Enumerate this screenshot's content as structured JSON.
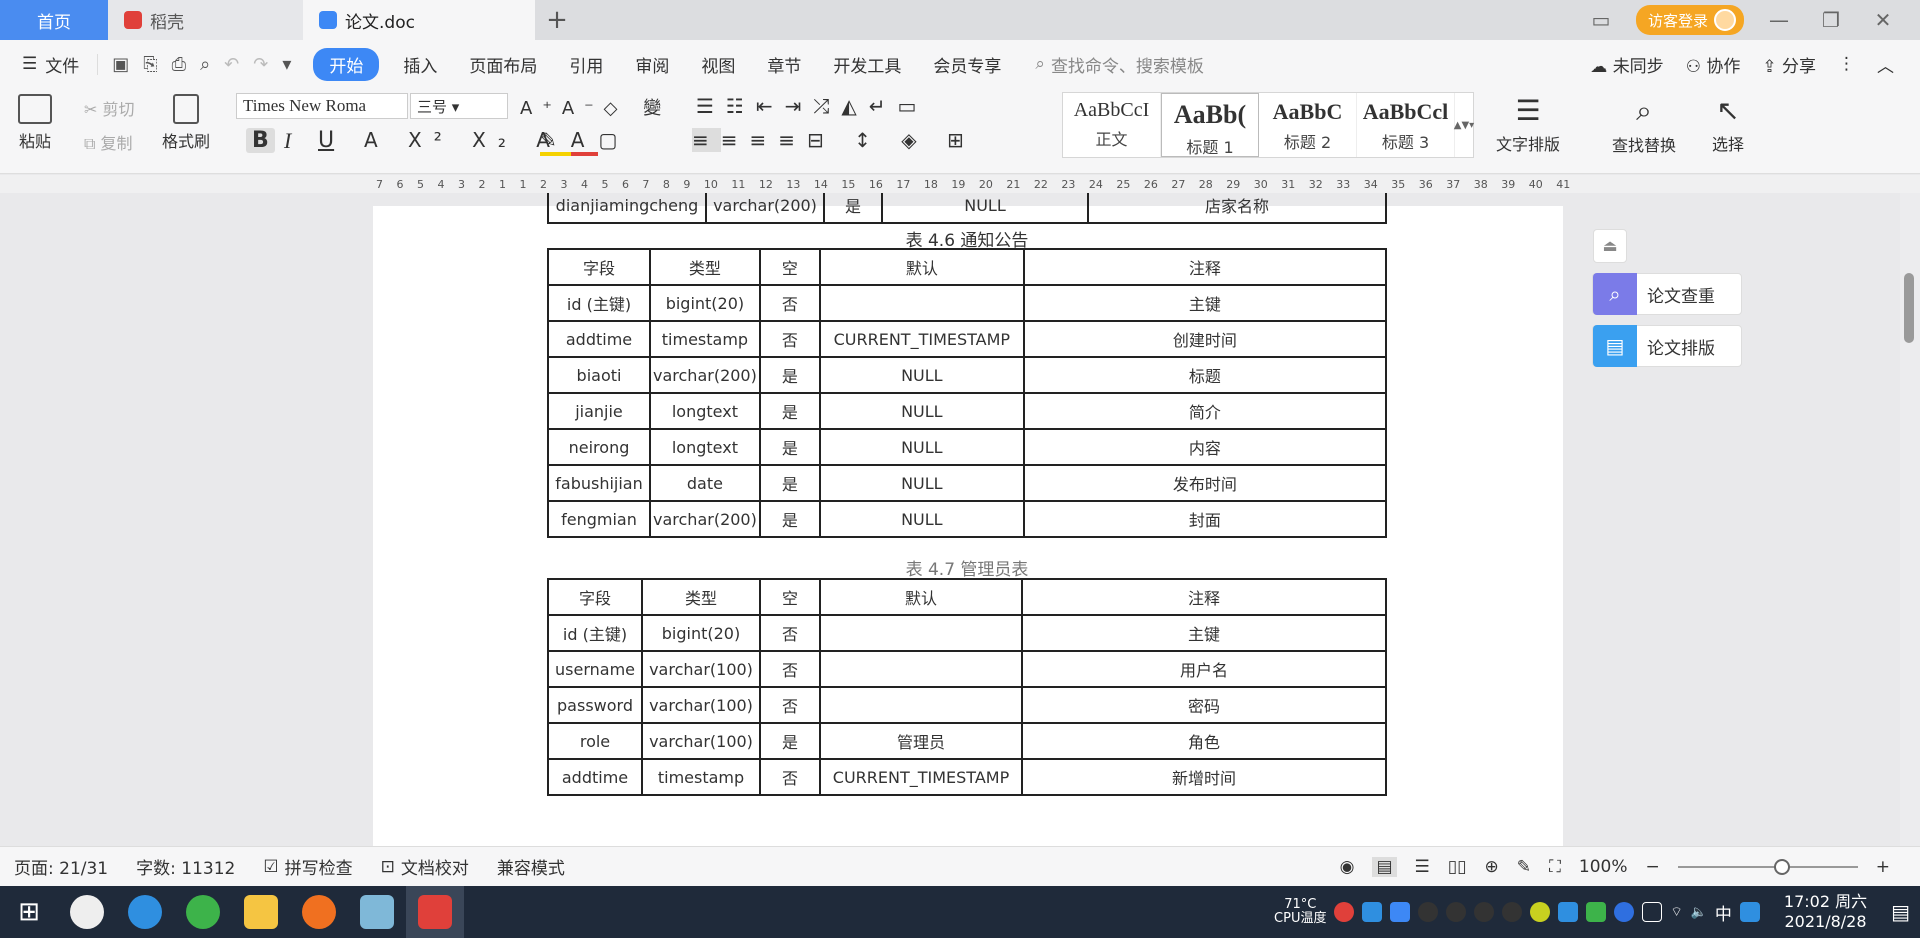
{
  "tabs": {
    "home": "首页",
    "daoke": "稻壳",
    "doc": "论文.doc",
    "login": "访客登录"
  },
  "menu": {
    "file": "文件",
    "items": [
      "开始",
      "插入",
      "页面布局",
      "引用",
      "审阅",
      "视图",
      "章节",
      "开发工具",
      "会员专享"
    ],
    "search_placeholder": "查找命令、搜索模板",
    "sync": "未同步",
    "collab": "协作",
    "share": "分享"
  },
  "ribbon": {
    "paste": "粘贴",
    "cut": "剪切",
    "copy": "复制",
    "format_painter": "格式刷",
    "font_name": "Times New Roma",
    "font_size": "三号",
    "styles": [
      {
        "sample": "AaBbCcI",
        "label": "正文"
      },
      {
        "sample": "AaBb(",
        "label": "标题 1"
      },
      {
        "sample": "AaBbC",
        "label": "标题 2"
      },
      {
        "sample": "AaBbCcl",
        "label": "标题 3"
      }
    ],
    "text_layout": "文字排版",
    "find_replace": "查找替换",
    "select": "选择"
  },
  "ruler_ticks": "7 6 5 4 3 2 1 1 2 3 4 5 6 7 8 9 10 11 12 13 14 15 16 17 18 19 20 21 22 23 24 25 26 27 28 29 30 31 32 33 34 35 36 37 38 39 40 41",
  "document": {
    "prev_row": [
      "dianjiamingcheng",
      "varchar(200)",
      "是",
      "NULL",
      "店家名称"
    ],
    "table6": {
      "caption": "表 4.6 通知公告",
      "header": [
        "字段",
        "类型",
        "空",
        "默认",
        "注释"
      ],
      "rows": [
        [
          "id (主键)",
          "bigint(20)",
          "否",
          "",
          "主键"
        ],
        [
          "addtime",
          "timestamp",
          "否",
          "CURRENT_TIMESTAMP",
          "创建时间"
        ],
        [
          "biaoti",
          "varchar(200)",
          "是",
          "NULL",
          "标题"
        ],
        [
          "jianjie",
          "longtext",
          "是",
          "NULL",
          "简介"
        ],
        [
          "neirong",
          "longtext",
          "是",
          "NULL",
          "内容"
        ],
        [
          "fabushijian",
          "date",
          "是",
          "NULL",
          "发布时间"
        ],
        [
          "fengmian",
          "varchar(200)",
          "是",
          "NULL",
          "封面"
        ]
      ]
    },
    "table7": {
      "caption": "表 4.7 管理员表",
      "header": [
        "字段",
        "类型",
        "空",
        "默认",
        "注释"
      ],
      "rows": [
        [
          "id (主键)",
          "bigint(20)",
          "否",
          "",
          "主键"
        ],
        [
          "username",
          "varchar(100)",
          "否",
          "",
          "用户名"
        ],
        [
          "password",
          "varchar(100)",
          "否",
          "",
          "密码"
        ],
        [
          "role",
          "varchar(100)",
          "是",
          "管理员",
          "角色"
        ],
        [
          "addtime",
          "timestamp",
          "否",
          "CURRENT_TIMESTAMP",
          "新增时间"
        ]
      ]
    }
  },
  "side_panel": {
    "check": "论文查重",
    "format": "论文排版"
  },
  "status": {
    "page": "页面: 21/31",
    "words": "字数: 11312",
    "spell": "拼写检查",
    "proof": "文档校对",
    "compat": "兼容模式",
    "zoom": "100%"
  },
  "taskbar": {
    "temp": "71°C",
    "temp_label": "CPU温度",
    "ime": "中",
    "time": "17:02 周六",
    "date": "2021/8/28"
  },
  "colors": {
    "accent": "#3d88f5",
    "home_tab": "#4a8cf0",
    "login": "#f5a623",
    "wps_red": "#e0403a"
  }
}
